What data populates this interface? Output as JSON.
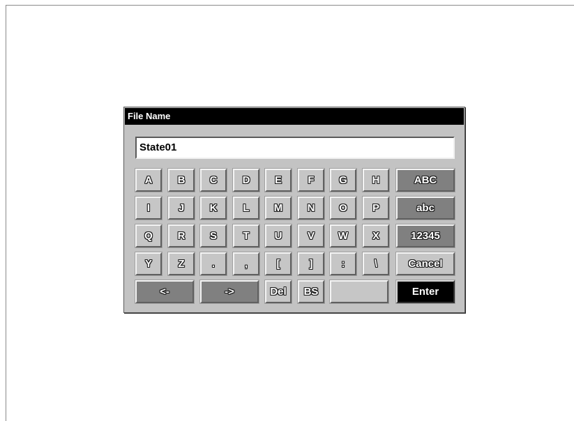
{
  "dialog": {
    "title": "File Name",
    "filename_value": "State01"
  },
  "keyboard": {
    "rows": [
      [
        "A",
        "B",
        "C",
        "D",
        "E",
        "F",
        "G",
        "H"
      ],
      [
        "I",
        "J",
        "K",
        "L",
        "M",
        "N",
        "O",
        "P"
      ],
      [
        "Q",
        "R",
        "S",
        "T",
        "U",
        "V",
        "W",
        "X"
      ],
      [
        "Y",
        "Z",
        ".",
        ",",
        "[",
        "]",
        ":",
        "\\"
      ]
    ],
    "mode_keys": {
      "upper": "ABC",
      "lower": "abc",
      "numeric": "12345",
      "cancel": "Cancel"
    },
    "bottom_row": {
      "left": "<-",
      "right": "->",
      "del": "Del",
      "bs": "BS",
      "blank": "",
      "enter": "Enter"
    }
  }
}
